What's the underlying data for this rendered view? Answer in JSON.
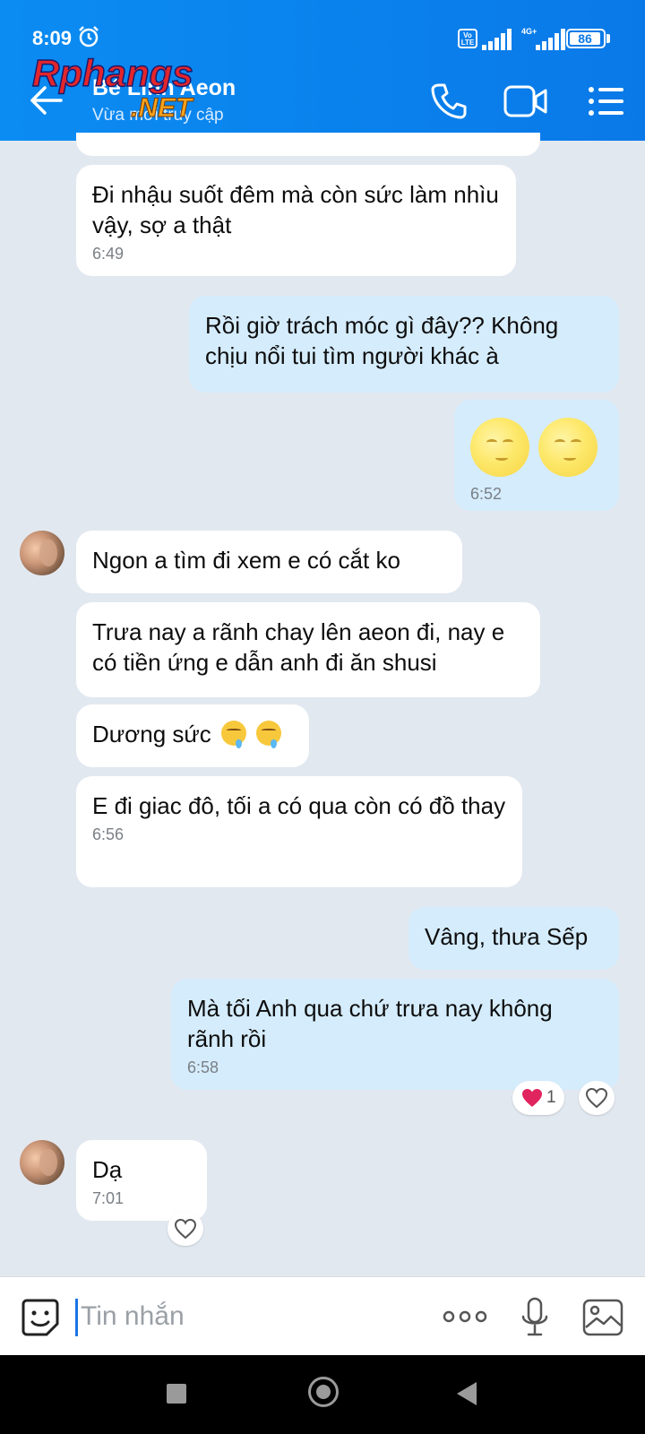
{
  "status_bar": {
    "time": "8:09",
    "volte": "Vo LTE",
    "network": "4G+",
    "battery": "86"
  },
  "header": {
    "contact_name": "Bé Linh Aeon",
    "contact_status": "Vừa mới truy cập",
    "watermark_text": "Rphangs .NET",
    "icons": [
      "back-arrow-icon",
      "phone-icon",
      "video-icon",
      "menu-icon"
    ]
  },
  "messages": [
    {
      "direction": "in",
      "text": "Đi nhậu suốt đêm mà còn sức làm nhìu vậy, sợ a thật",
      "time": "6:49"
    },
    {
      "direction": "out",
      "text": "Rồi giờ trách móc gì đây?? Không chịu nổi tui tìm người khác à",
      "time": ""
    },
    {
      "direction": "out",
      "text": "",
      "emoji": "sly-moon-face x2",
      "time": "6:52"
    },
    {
      "direction": "in",
      "text": "Ngon a tìm đi xem e có cắt ko",
      "time": ""
    },
    {
      "direction": "in",
      "text": "Trưa nay a rãnh chay lên aeon đi, nay e có tiền ứng e dẫn anh đi ăn shusi",
      "time": ""
    },
    {
      "direction": "in",
      "text": "Dương sức",
      "emoji": "drooling-face x2",
      "time": ""
    },
    {
      "direction": "in",
      "text": "E đi giac đô, tối a có qua còn có đồ thay",
      "time": "6:56"
    },
    {
      "direction": "out",
      "text": "Vâng, thưa Sếp",
      "time": ""
    },
    {
      "direction": "out",
      "text": "Mà tối Anh qua chứ trưa nay không rãnh rồi",
      "time": "6:58",
      "reaction_count": "1"
    },
    {
      "direction": "in",
      "text": "Dạ",
      "time": "7:01"
    }
  ],
  "composer": {
    "placeholder": "Tin nhắn"
  },
  "colors": {
    "header": "#0a79e8",
    "incoming_bubble": "#ffffff",
    "outgoing_bubble": "#d5ecfc",
    "chat_background": "#e2e8f0",
    "heart": "#e0245e"
  }
}
